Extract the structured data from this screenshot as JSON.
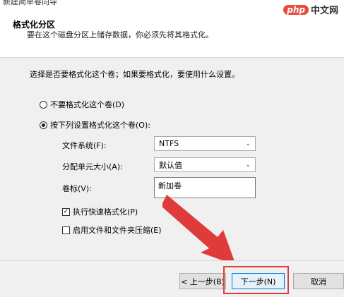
{
  "window": {
    "title": "新建简单卷向导"
  },
  "header": {
    "heading": "格式化分区",
    "description": "要在这个磁盘分区上储存数据，你必须先将其格式化。"
  },
  "watermark": {
    "badge": "php",
    "text": "中文网"
  },
  "main": {
    "question": "选择是否要格式化这个卷；如果要格式化，要使用什么设置。",
    "radio_no_format": "不要格式化这个卷(D)",
    "radio_format": "按下列设置格式化这个卷(O):",
    "filesystem_label": "文件系统(F):",
    "filesystem_value": "NTFS",
    "alloc_label": "分配单元大小(A):",
    "alloc_value": "默认值",
    "volume_label": "卷标(V):",
    "volume_value": "新加卷",
    "quick_format": "执行快速格式化(P)",
    "compression": "启用文件和文件夹压缩(E)"
  },
  "footer": {
    "back": "< 上一步(B)",
    "next": "下一步(N)",
    "cancel": "取消"
  },
  "colors": {
    "annotation": "#e03b3b",
    "primary_border": "#0078d7"
  }
}
